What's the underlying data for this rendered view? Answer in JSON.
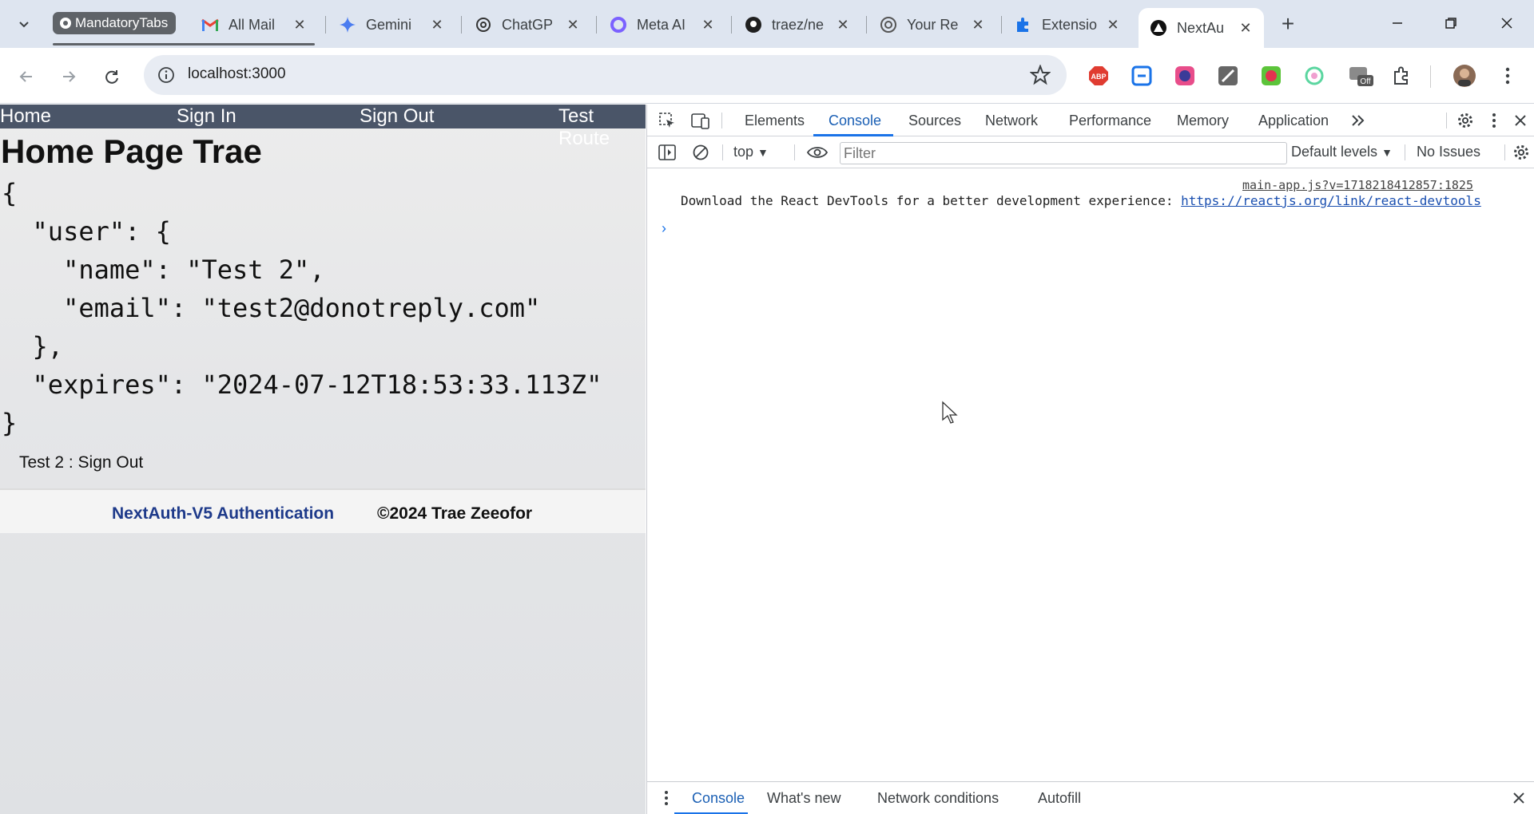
{
  "browser": {
    "tab_group": "MandatoryTabs",
    "tabs": [
      {
        "title": "All Mail"
      },
      {
        "title": "Gemini"
      },
      {
        "title": "ChatGP"
      },
      {
        "title": "Meta AI"
      },
      {
        "title": "traez/ne"
      },
      {
        "title": "Your Re"
      },
      {
        "title": "Extensio"
      },
      {
        "title": "NextAu"
      }
    ],
    "url": "localhost:3000"
  },
  "page": {
    "nav": [
      "Home",
      "Sign In",
      "Sign Out",
      "Test Route"
    ],
    "title": "Home Page Trae",
    "session_json": "{\n  \"user\": {\n    \"name\": \"Test 2\",\n    \"email\": \"test2@donotreply.com\"\n  },\n  \"expires\": \"2024-07-12T18:53:33.113Z\"\n}",
    "user_line": "Test 2 : Sign Out",
    "footer_link": "NextAuth-V5 Authentication",
    "footer_copy": "©2024 Trae Zeeofor"
  },
  "devtools": {
    "tabs": [
      "Elements",
      "Console",
      "Sources",
      "Network",
      "Performance",
      "Memory",
      "Application"
    ],
    "active_tab": "Console",
    "context": "top",
    "filter_placeholder": "Filter",
    "levels": "Default levels",
    "issues": "No Issues",
    "source": "main-app.js?v=1718218412857:1825",
    "message": "Download the React DevTools for a better development experience: ",
    "message_link": "https://reactjs.org/link/react-devtools",
    "drawer_tabs": [
      "Console",
      "What's new",
      "Network conditions",
      "Autofill"
    ]
  },
  "colors": {
    "site_nav": "#4a5568",
    "accent": "#1a73e8",
    "footer_link": "#1e3a8a"
  }
}
